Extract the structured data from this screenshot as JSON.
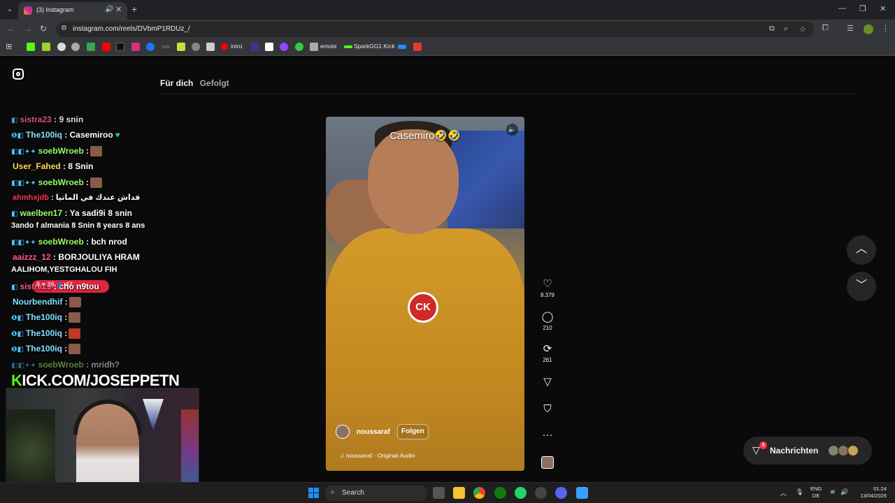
{
  "browser": {
    "tab_title": "(3) Instagram",
    "url": "instagram.com/reels/DVbmP1RDUz_/",
    "bookmarks": [
      {
        "label": "intro"
      },
      {
        "label": "emote"
      },
      {
        "label": "SparkGG1 Kick"
      }
    ]
  },
  "instagram": {
    "tabs": [
      "Für dich",
      "Gefolgt"
    ],
    "reel": {
      "caption": "Casemiro🤣🤣",
      "author": "noussaraf",
      "follow_label": "Folgen",
      "audio": "noussaraf · Original-Audio",
      "shirt_logo": "CK"
    },
    "actions": {
      "likes": "8.379",
      "comments": "210",
      "reposts": "261"
    },
    "messages": {
      "label": "Nachrichten",
      "badge": "3"
    }
  },
  "chat": [
    {
      "user": "sistra23",
      "msg": ": 9 snin",
      "color": "#ff5a86"
    },
    {
      "user": "The100iq",
      "msg": ": Casemiroo",
      "color": "#7fe3ff"
    },
    {
      "user": "soebWroeb",
      "msg": ":",
      "color": "#9bff6b"
    },
    {
      "user": "User_Fahed",
      "msg": ": 8 Snin",
      "color": "#ffd95a"
    },
    {
      "user": "soebWroeb",
      "msg": ":",
      "color": "#9bff6b"
    },
    {
      "user": "ahmhxjdb",
      "msg": ": قداش عندك في الماتيا",
      "color": "#ff3355"
    },
    {
      "user": "waelben17",
      "msg": ": Ya sadi9i 8 snin",
      "color": "#9bff6b"
    },
    {
      "user": "",
      "msg": "3ando f almania 8 Snin 8 years 8 ans",
      "color": "#ffffff"
    },
    {
      "user": "soebWroeb",
      "msg": ": bch nrod",
      "color": "#9bff6b"
    },
    {
      "user": "aaizzz_12",
      "msg": ": BORJOULIYA HRAM",
      "color": "#ff5a86"
    },
    {
      "user": "",
      "msg": "AALIHOM,YESTGHALOU FIH",
      "color": "#ffffff"
    },
    {
      "user": "sistra23",
      "msg": ": cho n9tou",
      "color": "#ff5a86"
    },
    {
      "user": "Nourbendhif",
      "msg": ":",
      "color": "#7fe3ff"
    },
    {
      "user": "The100iq",
      "msg": ":",
      "color": "#7fe3ff"
    },
    {
      "user": "The100iq",
      "msg": ":",
      "color": "#7fe3ff"
    },
    {
      "user": "The100iq",
      "msg": ":",
      "color": "#7fe3ff"
    },
    {
      "user": "soebWroeb",
      "msg": ": mridh?",
      "color": "#9bff6b"
    }
  ],
  "stream": {
    "banner_k": "K",
    "banner_rest": "ICK.COM/JOSEPPETN",
    "live_stats": "8 ♥ 28 👤 47"
  },
  "taskbar": {
    "search": "Search",
    "lang_top": "ENG",
    "lang_bottom": "DE",
    "time": "01:24",
    "date": "13/04/2026"
  }
}
